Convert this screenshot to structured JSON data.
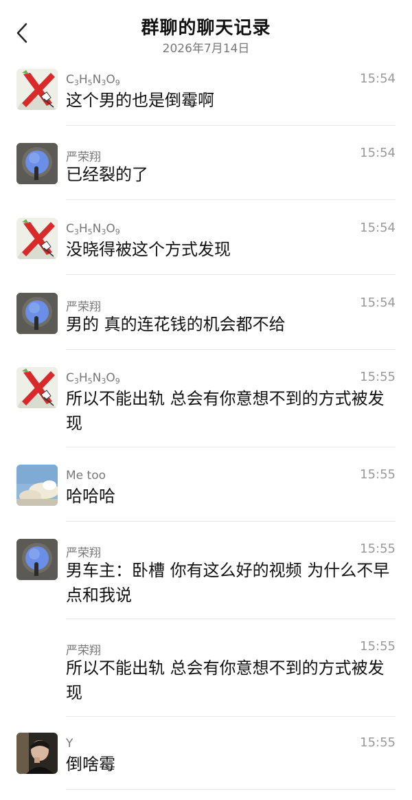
{
  "header": {
    "title": "群聊的聊天记录",
    "date": "2026年7月14日"
  },
  "messages": [
    {
      "sender": "C3H5N3O9",
      "time": "15:54",
      "text": "这个男的也是倒霉啊",
      "avatar": "red-x-avatar"
    },
    {
      "sender": "严荣翔",
      "time": "15:54",
      "text": "已经裂的了",
      "avatar": "blue-circle-avatar"
    },
    {
      "sender": "C3H5N3O9",
      "time": "15:54",
      "text": "没晓得被这个方式发现",
      "avatar": "red-x-avatar"
    },
    {
      "sender": "严荣翔",
      "time": "15:54",
      "text": "男的 真的连花钱的机会都不给",
      "avatar": "blue-circle-avatar"
    },
    {
      "sender": "C3H5N3O9",
      "time": "15:55",
      "text": "所以不能出轨 总会有你意想不到的方式被发现",
      "avatar": "red-x-avatar"
    },
    {
      "sender": "Me too",
      "time": "15:55",
      "text": "哈哈哈",
      "avatar": "sky-cloud-avatar"
    },
    {
      "sender": "严荣翔",
      "time": "15:55",
      "text": "男车主：卧槽 你有这么好的视频 为什么不早点和我说",
      "avatar": "blue-circle-avatar"
    },
    {
      "sender": "严荣翔",
      "time": "15:55",
      "text": "所以不能出轨 总会有你意想不到的方式被发现",
      "avatar": "none"
    },
    {
      "sender": "Y",
      "time": "15:55",
      "text": "倒啥霉",
      "avatar": "person-photo-avatar"
    }
  ]
}
